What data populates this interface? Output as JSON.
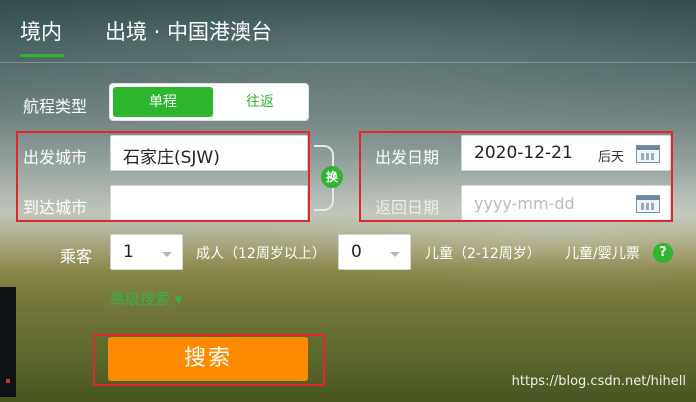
{
  "tabs": {
    "domestic": "境内",
    "international": "出境 · 中国港澳台"
  },
  "trip_type": {
    "label": "航程类型",
    "one_way": "单程",
    "round_trip": "往返",
    "selected": "单程"
  },
  "cities": {
    "departure_label": "出发城市",
    "departure_value": "石家庄(SJW)",
    "arrival_label": "到达城市",
    "arrival_value": "",
    "swap_label": "换"
  },
  "dates": {
    "departure_label": "出发日期",
    "departure_value": "2020-12-21",
    "departure_hint": "后天",
    "return_label": "返回日期",
    "return_placeholder": "yyyy-mm-dd"
  },
  "passengers": {
    "label": "乘客",
    "adults": "1",
    "adults_label": "成人（12周岁以上）",
    "children": "0",
    "children_label": "儿童（2-12周岁）",
    "infant_label": "儿童/婴儿票",
    "help_icon": "?"
  },
  "advanced_search": "高级搜索 ▾",
  "search_button": "搜索",
  "watermark": "https://blog.csdn.net/hihell",
  "colors": {
    "accent_green": "#2db52d",
    "search_orange": "#ff8a00",
    "annotation_red": "#e3262c"
  }
}
